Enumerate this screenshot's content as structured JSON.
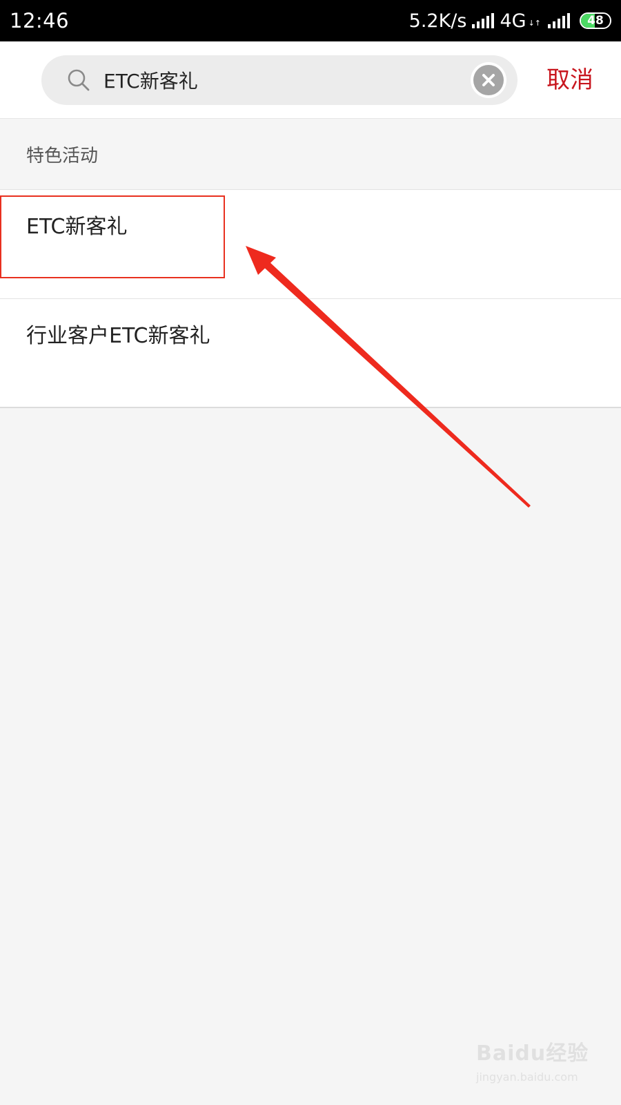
{
  "status_bar": {
    "time": "12:46",
    "speed": "5.2K/s",
    "network": "4G",
    "network_arrows": "↓↑",
    "battery": "48",
    "battery_level_percent": 48
  },
  "search": {
    "query": "ETC新客礼",
    "cancel_label": "取消"
  },
  "section": {
    "title": "特色活动"
  },
  "results": [
    {
      "label": "ETC新客礼"
    },
    {
      "label": "行业客户ETC新客礼"
    }
  ],
  "watermark": {
    "logo": "Baidu经验",
    "url": "jingyan.baidu.com"
  },
  "colors": {
    "accent": "#c8161e",
    "annotation": "#e8301f",
    "status_bar": "#000000",
    "background": "#f5f5f5"
  },
  "icons": {
    "search": "search-icon",
    "clear": "close-circle-icon",
    "signal": "signal-icon",
    "battery": "battery-icon"
  }
}
